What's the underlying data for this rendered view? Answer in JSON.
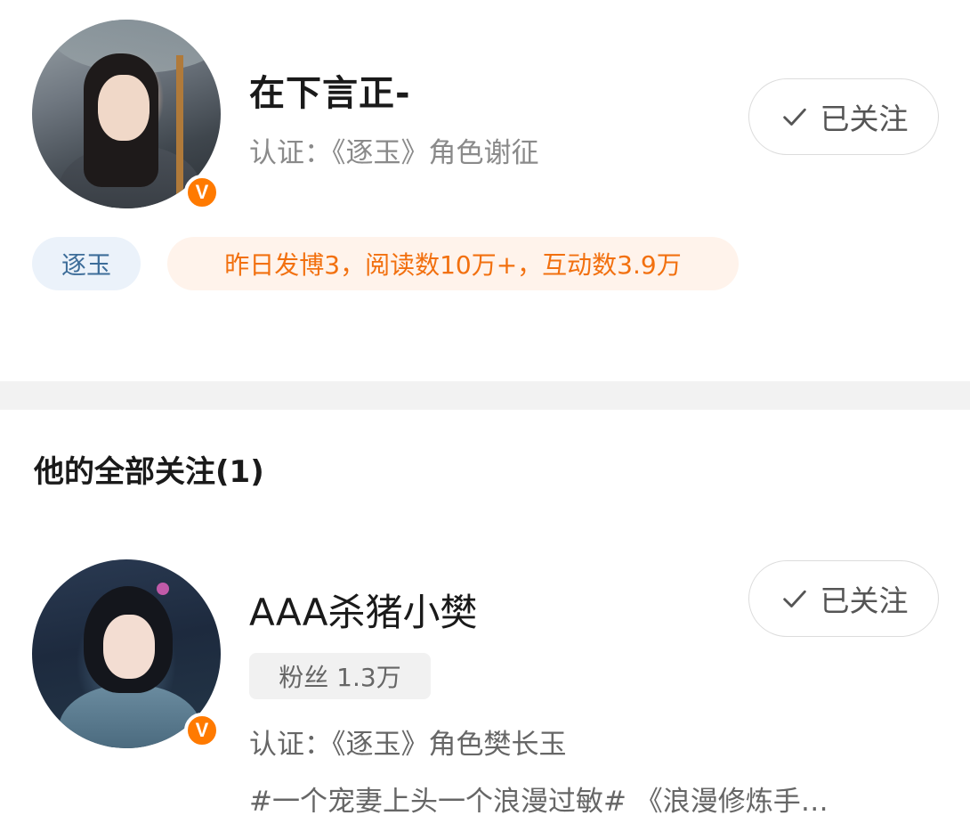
{
  "profile": {
    "name": "在下言正-",
    "verification": "认证：《逐玉》角色谢征",
    "badge_letter": "V",
    "follow_status": "已关注",
    "topic_tag": "逐玉",
    "stats": "昨日发博3，阅读数10万+，互动数3.9万"
  },
  "following": {
    "title": "他的全部关注(1)",
    "items": [
      {
        "name": "AAA杀猪小樊",
        "fans": "粉丝 1.3万",
        "verification": "认证：《逐玉》角色樊长玉",
        "description": "#一个宠妻上头一个浪漫过敏# 《浪漫修炼手…",
        "badge_letter": "V",
        "follow_status": "已关注"
      }
    ]
  },
  "colors": {
    "badge_orange": "#ff7a00",
    "stats_orange": "#f2700f",
    "topic_blue": "#3d6d99",
    "divider_gray": "#f2f2f2"
  },
  "icons": {
    "avatar_badge": "verified-v-icon",
    "follow_button": "check-icon"
  }
}
